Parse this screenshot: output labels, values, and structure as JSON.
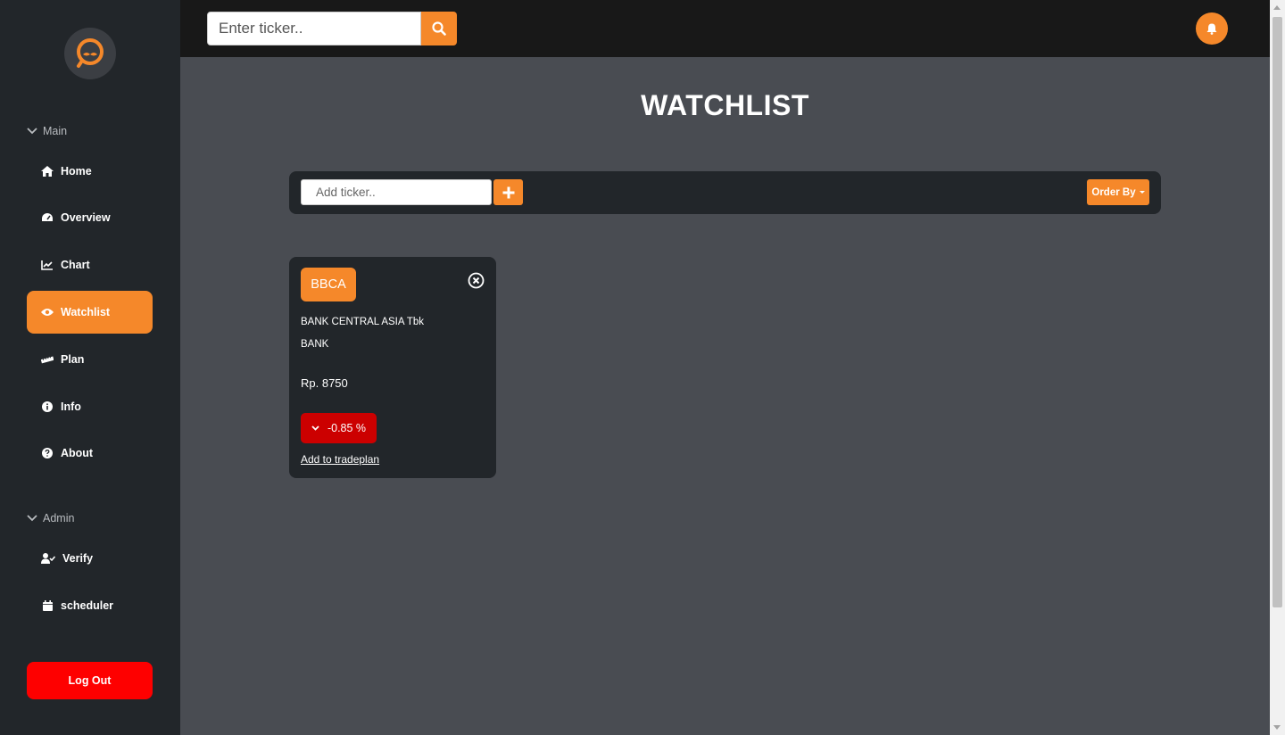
{
  "sidebar": {
    "sections": [
      {
        "label": "Main"
      },
      {
        "label": "Admin"
      }
    ],
    "main_items": [
      {
        "label": "Home",
        "icon": "home-icon"
      },
      {
        "label": "Overview",
        "icon": "gauge-icon"
      },
      {
        "label": "Chart",
        "icon": "line-chart-icon"
      },
      {
        "label": "Watchlist",
        "icon": "eye-icon",
        "active": true
      },
      {
        "label": "Plan",
        "icon": "ruler-icon"
      },
      {
        "label": "Info",
        "icon": "info-icon"
      },
      {
        "label": "About",
        "icon": "question-icon"
      }
    ],
    "admin_items": [
      {
        "label": "Verify",
        "icon": "user-check-icon"
      },
      {
        "label": "scheduler",
        "icon": "calendar-icon"
      }
    ],
    "logout_label": "Log Out"
  },
  "topbar": {
    "search_placeholder": "Enter ticker.."
  },
  "main": {
    "title": "WATCHLIST",
    "add_placeholder": "Add ticker..",
    "order_label": "Order By"
  },
  "watchlist": [
    {
      "ticker": "BBCA",
      "name": "BANK CENTRAL ASIA Tbk",
      "sector": "BANK",
      "price": "Rp. 8750",
      "change": "-0.85 %",
      "action_label": "Add to tradeplan"
    }
  ],
  "colors": {
    "accent": "#f5882a",
    "sidebar_bg": "#22262a",
    "content_bg": "#494c52",
    "topbar_bg": "#181818",
    "negative": "#cc0000",
    "logout": "#fe0000"
  }
}
